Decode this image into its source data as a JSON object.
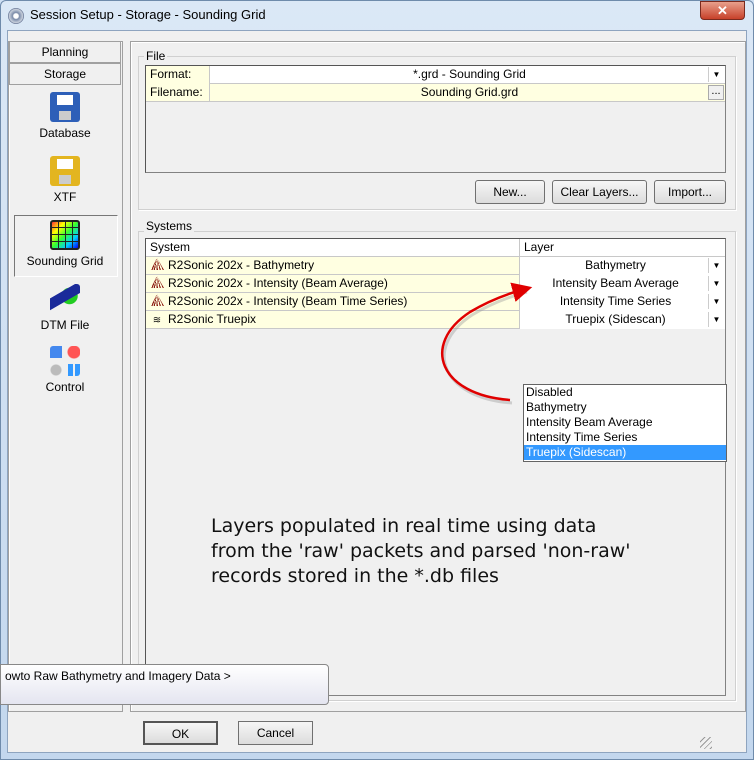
{
  "window": {
    "title": "Session Setup - Storage -  Sounding Grid",
    "close": "✕"
  },
  "sidebar": {
    "tabs": [
      "Planning",
      "Storage"
    ],
    "items": [
      {
        "label": "Database",
        "icon": "floppy-blue-icon"
      },
      {
        "label": "XTF",
        "icon": "floppy-yellow-icon"
      },
      {
        "label": "Sounding Grid",
        "icon": "sounding-grid-icon",
        "selected": true
      },
      {
        "label": "DTM File",
        "icon": "dtm-icon"
      },
      {
        "label": "Control",
        "icon": "control-icon"
      }
    ]
  },
  "file": {
    "group_label": "File",
    "format_label": "Format:",
    "format_value": "*.grd - Sounding Grid",
    "filename_label": "Filename:",
    "filename_value": "Sounding Grid.grd",
    "browse": "...",
    "buttons": {
      "new": "New...",
      "clear": "Clear Layers...",
      "import": "Import..."
    }
  },
  "systems": {
    "group_label": "Systems",
    "headers": [
      "System",
      "Layer"
    ],
    "rows": [
      {
        "system": "R2Sonic 202x - Bathymetry",
        "layer": "Bathymetry"
      },
      {
        "system": "R2Sonic 202x - Intensity (Beam Average)",
        "layer": "Intensity Beam Average"
      },
      {
        "system": "R2Sonic 202x - Intensity (Beam Time Series)",
        "layer": "Intensity Time Series"
      },
      {
        "system": "R2Sonic Truepix",
        "layer": "Truepix (Sidescan)"
      }
    ],
    "dropdown_options": [
      "Disabled",
      "Bathymetry",
      "Intensity Beam Average",
      "Intensity Time Series",
      "Truepix (Sidescan)"
    ],
    "dropdown_selected": "Truepix (Sidescan)"
  },
  "annotation": [
    "Layers populated in real time using data",
    "from the 'raw' packets and parsed 'non-raw'",
    "records stored in the *.db files"
  ],
  "tooltip": "owto Raw Bathymetry and Imagery Data >",
  "footer": {
    "ok": "OK",
    "cancel": "Cancel"
  },
  "colors": {
    "row_bg": "#ffffe1",
    "selection": "#3399ff",
    "arrow": "#e00000"
  }
}
